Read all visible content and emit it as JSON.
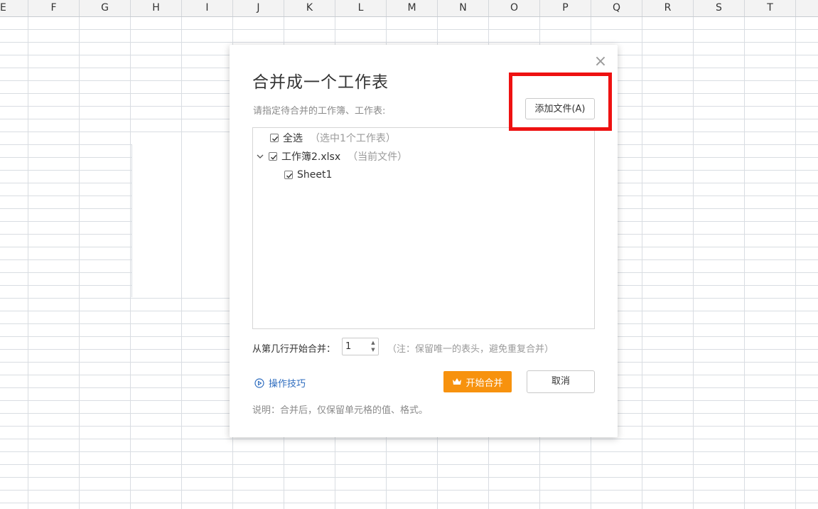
{
  "spreadsheet": {
    "columns": [
      "E",
      "F",
      "G",
      "H",
      "I",
      "J",
      "K",
      "L",
      "M",
      "N",
      "O",
      "P",
      "Q",
      "R",
      "S",
      "T"
    ]
  },
  "dialog": {
    "title": "合并成一个工作表",
    "subtitle": "请指定待合并的工作簿、工作表:",
    "add_file_label": "添加文件(A)",
    "tree": {
      "select_all_label": "全选",
      "select_all_note": "（选中1个工作表）",
      "workbook_label": "工作簿2.xlsx",
      "workbook_note": "（当前文件）",
      "sheet_label": "Sheet1"
    },
    "start_row_label": "从第几行开始合并：",
    "start_row_value": "1",
    "start_row_note": "（注：保留唯一的表头，避免重复合并）",
    "tips_label": "操作技巧",
    "merge_button_label": "开始合并",
    "cancel_button_label": "取消",
    "footer_note": "说明：合并后，仅保留单元格的值、格式。",
    "close_glyph": "×"
  },
  "colors": {
    "accent_orange": "#f7920e",
    "link_blue": "#2f6dbf",
    "highlight_red": "#ee1111"
  }
}
